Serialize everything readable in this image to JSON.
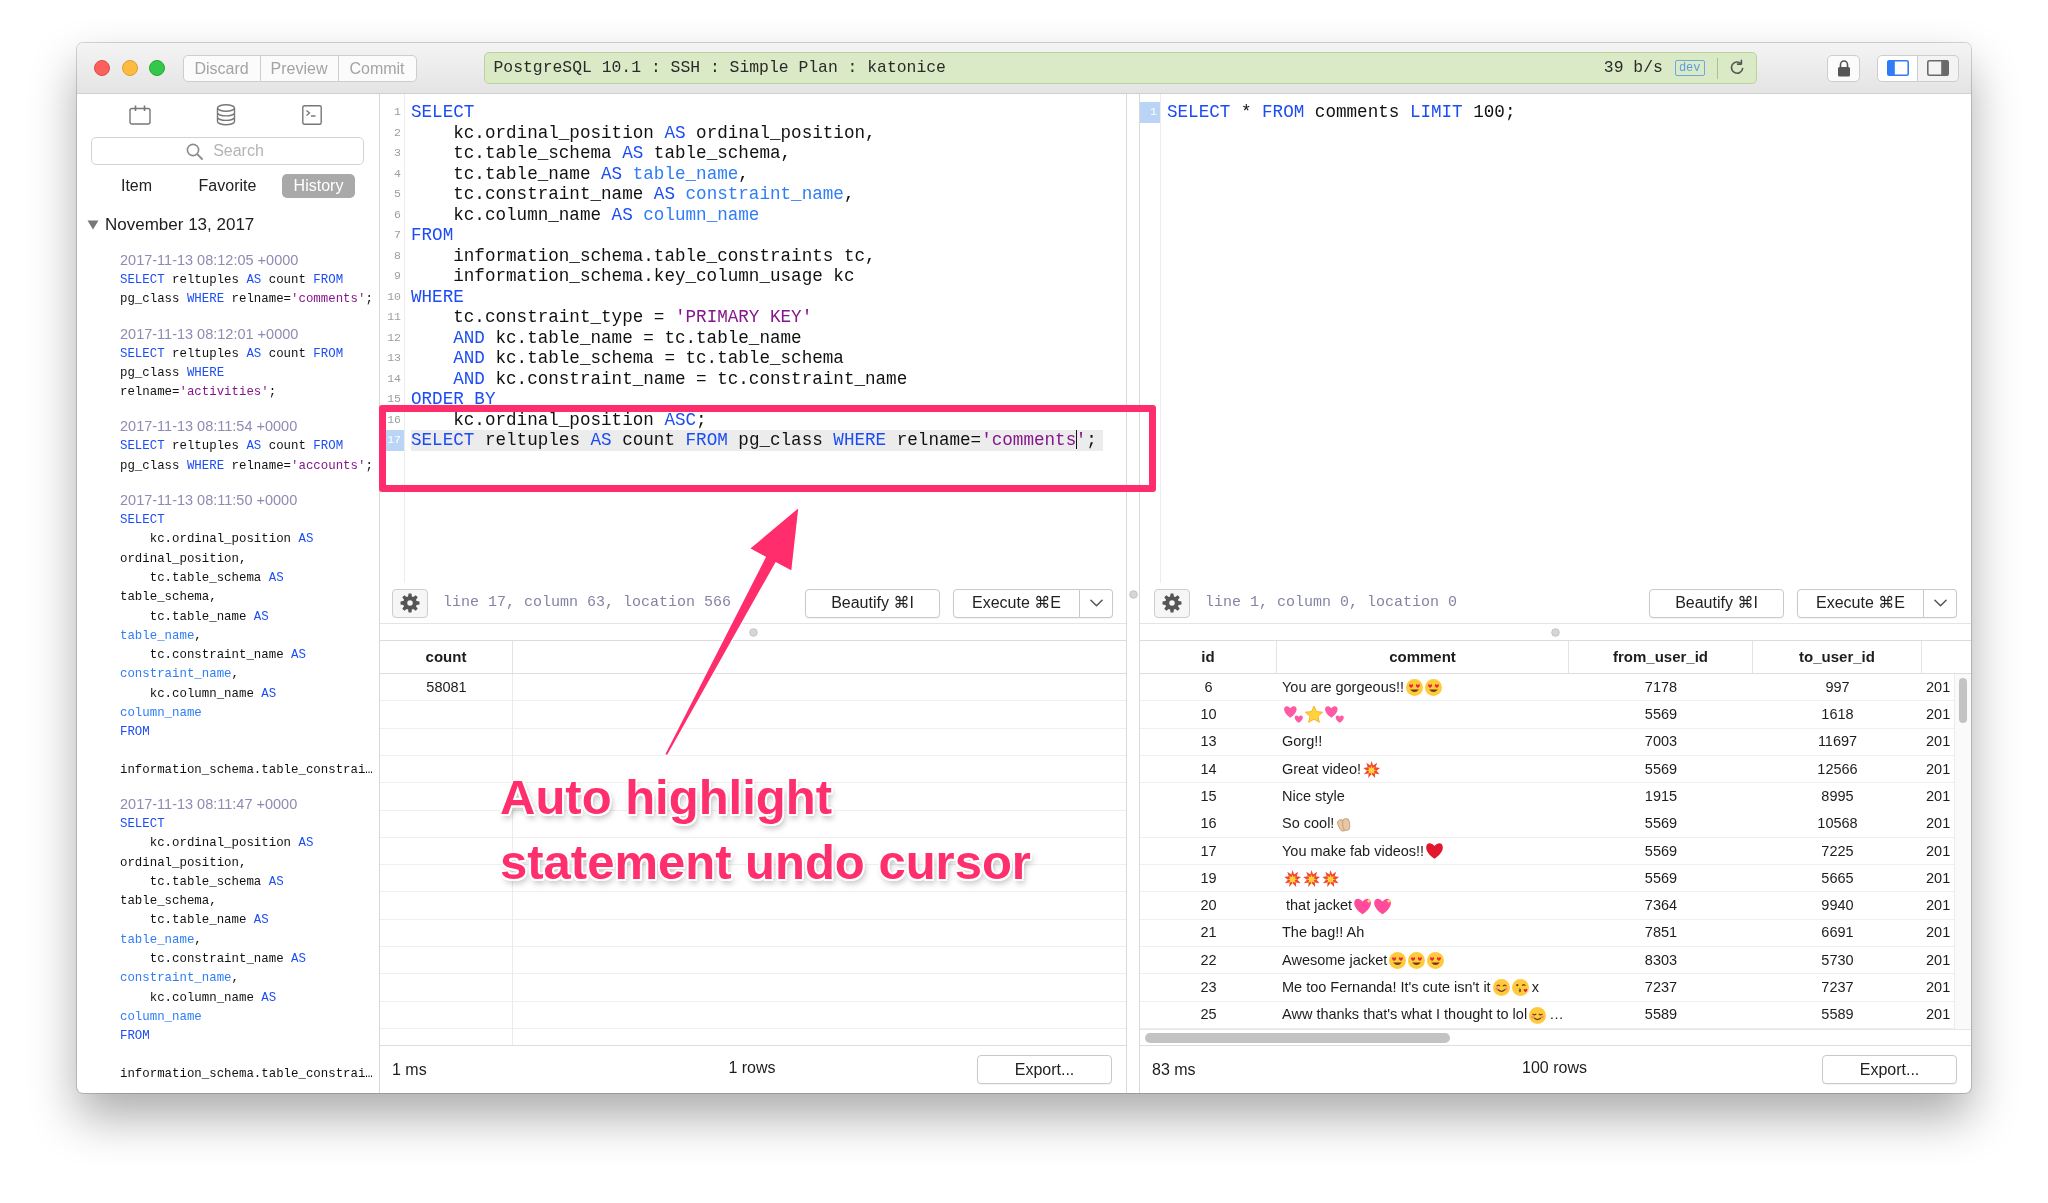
{
  "toolbar": {
    "buttons": [
      {
        "label": "Discard",
        "disabled": true
      },
      {
        "label": "Preview",
        "disabled": true
      },
      {
        "label": "Commit",
        "disabled": true
      }
    ],
    "connection": {
      "title": "PostgreSQL 10.1 : SSH : Simple Plan : katonice",
      "rate": "39 b/s",
      "environment": "dev"
    },
    "panel_toggles": [
      {
        "kind": "left",
        "selected": true
      },
      {
        "kind": "right",
        "selected": false
      }
    ]
  },
  "sidebar": {
    "search": {
      "placeholder": "Search"
    },
    "tabs": [
      {
        "label": "Item",
        "selected": false
      },
      {
        "label": "Favorite",
        "selected": false
      },
      {
        "label": "History",
        "selected": true
      }
    ],
    "history": [
      {
        "label": "November 13, 2017",
        "expanded": true,
        "children": [
          {
            "time": "2017-11-13 08:12:05 +0000",
            "lines": [
              [
                {
                  "kind": "keyword",
                  "text": "SELECT"
                },
                {
                  "kind": "plain",
                  "text": " reltuples "
                },
                {
                  "kind": "keyword",
                  "text": "AS"
                },
                {
                  "kind": "plain",
                  "text": " count "
                },
                {
                  "kind": "keyword",
                  "text": "FROM"
                }
              ],
              [
                {
                  "kind": "plain",
                  "text": "pg_class "
                },
                {
                  "kind": "keyword",
                  "text": "WHERE"
                },
                {
                  "kind": "plain",
                  "text": " relname="
                },
                {
                  "kind": "string",
                  "text": "'comments'"
                },
                {
                  "kind": "plain",
                  "text": ";"
                }
              ]
            ]
          },
          {
            "time": "2017-11-13 08:12:01 +0000",
            "lines": [
              [
                {
                  "kind": "keyword",
                  "text": "SELECT"
                },
                {
                  "kind": "plain",
                  "text": " reltuples "
                },
                {
                  "kind": "keyword",
                  "text": "AS"
                },
                {
                  "kind": "plain",
                  "text": " count "
                },
                {
                  "kind": "keyword",
                  "text": "FROM"
                }
              ],
              [
                {
                  "kind": "plain",
                  "text": "pg_class "
                },
                {
                  "kind": "keyword",
                  "text": "WHERE"
                }
              ],
              [
                {
                  "kind": "plain",
                  "text": "relname="
                },
                {
                  "kind": "string",
                  "text": "'activities'"
                },
                {
                  "kind": "plain",
                  "text": ";"
                }
              ]
            ]
          },
          {
            "time": "2017-11-13 08:11:54 +0000",
            "lines": [
              [
                {
                  "kind": "keyword",
                  "text": "SELECT"
                },
                {
                  "kind": "plain",
                  "text": " reltuples "
                },
                {
                  "kind": "keyword",
                  "text": "AS"
                },
                {
                  "kind": "plain",
                  "text": " count "
                },
                {
                  "kind": "keyword",
                  "text": "FROM"
                }
              ],
              [
                {
                  "kind": "plain",
                  "text": "pg_class "
                },
                {
                  "kind": "keyword",
                  "text": "WHERE"
                },
                {
                  "kind": "plain",
                  "text": " relname="
                },
                {
                  "kind": "string",
                  "text": "'accounts'"
                },
                {
                  "kind": "plain",
                  "text": ";"
                }
              ]
            ]
          },
          {
            "time": "2017-11-13 08:11:50 +0000",
            "lines": [
              [
                {
                  "kind": "keyword",
                  "text": "SELECT"
                }
              ],
              [
                {
                  "kind": "plain",
                  "text": "    kc.ordinal_position "
                },
                {
                  "kind": "keyword",
                  "text": "AS"
                }
              ],
              [
                {
                  "kind": "plain",
                  "text": "ordinal_position,"
                }
              ],
              [
                {
                  "kind": "plain",
                  "text": "    tc.table_schema "
                },
                {
                  "kind": "keyword",
                  "text": "AS"
                }
              ],
              [
                {
                  "kind": "plain",
                  "text": "table_schema,"
                }
              ],
              [
                {
                  "kind": "plain",
                  "text": "    tc.table_name "
                },
                {
                  "kind": "keyword",
                  "text": "AS"
                }
              ],
              [
                {
                  "kind": "name",
                  "text": "table_name"
                },
                {
                  "kind": "plain",
                  "text": ","
                }
              ],
              [
                {
                  "kind": "plain",
                  "text": "    tc.constraint_name "
                },
                {
                  "kind": "keyword",
                  "text": "AS"
                }
              ],
              [
                {
                  "kind": "name",
                  "text": "constraint_name"
                },
                {
                  "kind": "plain",
                  "text": ","
                }
              ],
              [
                {
                  "kind": "plain",
                  "text": "    kc.column_name "
                },
                {
                  "kind": "keyword",
                  "text": "AS"
                }
              ],
              [
                {
                  "kind": "name",
                  "text": "column_name"
                }
              ],
              [
                {
                  "kind": "keyword",
                  "text": "FROM"
                }
              ]
            ],
            "truncated_line": "information_schema.table_constrai…"
          },
          {
            "time": "2017-11-13 08:11:47 +0000",
            "lines": [
              [
                {
                  "kind": "keyword",
                  "text": "SELECT"
                }
              ],
              [
                {
                  "kind": "plain",
                  "text": "    kc.ordinal_position "
                },
                {
                  "kind": "keyword",
                  "text": "AS"
                }
              ],
              [
                {
                  "kind": "plain",
                  "text": "ordinal_position,"
                }
              ],
              [
                {
                  "kind": "plain",
                  "text": "    tc.table_schema "
                },
                {
                  "kind": "keyword",
                  "text": "AS"
                }
              ],
              [
                {
                  "kind": "plain",
                  "text": "table_schema,"
                }
              ],
              [
                {
                  "kind": "plain",
                  "text": "    tc.table_name "
                },
                {
                  "kind": "keyword",
                  "text": "AS"
                }
              ],
              [
                {
                  "kind": "name",
                  "text": "table_name"
                },
                {
                  "kind": "plain",
                  "text": ","
                }
              ],
              [
                {
                  "kind": "plain",
                  "text": "    tc.constraint_name "
                },
                {
                  "kind": "keyword",
                  "text": "AS"
                }
              ],
              [
                {
                  "kind": "name",
                  "text": "constraint_name"
                },
                {
                  "kind": "plain",
                  "text": ","
                }
              ],
              [
                {
                  "kind": "plain",
                  "text": "    kc.column_name "
                },
                {
                  "kind": "keyword",
                  "text": "AS"
                }
              ],
              [
                {
                  "kind": "name",
                  "text": "column_name"
                }
              ],
              [
                {
                  "kind": "keyword",
                  "text": "FROM"
                }
              ]
            ],
            "truncated_line": "information_schema.table_constrai…"
          }
        ]
      }
    ]
  },
  "panes": [
    {
      "editor": {
        "lines": [
          {
            "number": "1",
            "current": false,
            "highlighted": false,
            "segments": [
              {
                "kind": "keyword",
                "text": "SELECT"
              }
            ]
          },
          {
            "number": "2",
            "current": false,
            "highlighted": false,
            "segments": [
              {
                "kind": "plain",
                "text": "    kc.ordinal_position "
              },
              {
                "kind": "keyword",
                "text": "AS"
              },
              {
                "kind": "plain",
                "text": " ordinal_position,"
              }
            ]
          },
          {
            "number": "3",
            "current": false,
            "highlighted": false,
            "segments": [
              {
                "kind": "plain",
                "text": "    tc.table_schema "
              },
              {
                "kind": "keyword",
                "text": "AS"
              },
              {
                "kind": "plain",
                "text": " table_schema,"
              }
            ]
          },
          {
            "number": "4",
            "current": false,
            "highlighted": false,
            "segments": [
              {
                "kind": "plain",
                "text": "    tc.table_name "
              },
              {
                "kind": "keyword",
                "text": "AS"
              },
              {
                "kind": "name",
                "text": " table_name"
              },
              {
                "kind": "plain",
                "text": ","
              }
            ]
          },
          {
            "number": "5",
            "current": false,
            "highlighted": false,
            "segments": [
              {
                "kind": "plain",
                "text": "    tc.constraint_name "
              },
              {
                "kind": "keyword",
                "text": "AS"
              },
              {
                "kind": "name",
                "text": " constraint_name"
              },
              {
                "kind": "plain",
                "text": ","
              }
            ]
          },
          {
            "number": "6",
            "current": false,
            "highlighted": false,
            "segments": [
              {
                "kind": "plain",
                "text": "    kc.column_name "
              },
              {
                "kind": "keyword",
                "text": "AS"
              },
              {
                "kind": "name",
                "text": " column_name"
              }
            ]
          },
          {
            "number": "7",
            "current": false,
            "highlighted": false,
            "segments": [
              {
                "kind": "keyword",
                "text": "FROM"
              }
            ]
          },
          {
            "number": "8",
            "current": false,
            "highlighted": false,
            "segments": [
              {
                "kind": "plain",
                "text": "    information_schema.table_constraints tc,"
              }
            ]
          },
          {
            "number": "9",
            "current": false,
            "highlighted": false,
            "segments": [
              {
                "kind": "plain",
                "text": "    information_schema.key_column_usage kc"
              }
            ]
          },
          {
            "number": "10",
            "current": false,
            "highlighted": false,
            "segments": [
              {
                "kind": "keyword",
                "text": "WHERE"
              }
            ]
          },
          {
            "number": "11",
            "current": false,
            "highlighted": false,
            "segments": [
              {
                "kind": "plain",
                "text": "    tc.constraint_type = "
              },
              {
                "kind": "string",
                "text": "'PRIMARY KEY'"
              }
            ]
          },
          {
            "number": "12",
            "current": false,
            "highlighted": false,
            "segments": [
              {
                "kind": "keyword",
                "text": "    AND"
              },
              {
                "kind": "plain",
                "text": " kc.table_name = tc.table_name"
              }
            ]
          },
          {
            "number": "13",
            "current": false,
            "highlighted": false,
            "segments": [
              {
                "kind": "keyword",
                "text": "    AND"
              },
              {
                "kind": "plain",
                "text": " kc.table_schema = tc.table_schema"
              }
            ]
          },
          {
            "number": "14",
            "current": false,
            "highlighted": false,
            "segments": [
              {
                "kind": "keyword",
                "text": "    AND"
              },
              {
                "kind": "plain",
                "text": " kc.constraint_name = tc.constraint_name"
              }
            ]
          },
          {
            "number": "15",
            "current": false,
            "highlighted": false,
            "segments": [
              {
                "kind": "keyword",
                "text": "ORDER BY"
              }
            ]
          },
          {
            "number": "16",
            "current": false,
            "highlighted": false,
            "segments": [
              {
                "kind": "plain",
                "text": "    kc.ordinal_position "
              },
              {
                "kind": "keyword",
                "text": "ASC"
              },
              {
                "kind": "plain",
                "text": ";"
              }
            ]
          },
          {
            "number": "17",
            "current": true,
            "highlighted": true,
            "segments": [
              {
                "kind": "keyword",
                "text": "SELECT"
              },
              {
                "kind": "plain",
                "text": " reltuples "
              },
              {
                "kind": "keyword",
                "text": "AS"
              },
              {
                "kind": "plain",
                "text": " count "
              },
              {
                "kind": "keyword",
                "text": "FROM"
              },
              {
                "kind": "plain",
                "text": " pg_class "
              },
              {
                "kind": "keyword",
                "text": "WHERE"
              },
              {
                "kind": "plain",
                "text": " relname="
              },
              {
                "kind": "string",
                "text": "'comments"
              },
              {
                "kind": "cursor"
              },
              {
                "kind": "string",
                "text": "'"
              },
              {
                "kind": "plain",
                "text": ";"
              }
            ]
          }
        ]
      },
      "status": "line 17, column 63, location 566",
      "actions": [
        {
          "kind": "plain",
          "label": "Beautify ⌘I"
        },
        {
          "kind": "split",
          "label": "Execute ⌘E"
        }
      ],
      "results": {
        "columns": [
          "count"
        ],
        "rows": [
          {
            "cells": [
              "58081"
            ]
          }
        ]
      },
      "footer": {
        "time": "1 ms",
        "count": "1 rows",
        "export": "Export..."
      }
    },
    {
      "editor": {
        "lines": [
          {
            "number": "1",
            "current": true,
            "highlighted": false,
            "segments": [
              {
                "kind": "keyword",
                "text": "SELECT"
              },
              {
                "kind": "plain",
                "text": " * "
              },
              {
                "kind": "keyword",
                "text": "FROM"
              },
              {
                "kind": "plain",
                "text": " comments "
              },
              {
                "kind": "keyword",
                "text": "LIMIT"
              },
              {
                "kind": "plain",
                "text": " 100;"
              }
            ]
          }
        ]
      },
      "status": "line 1, column 0, location 0",
      "actions": [
        {
          "kind": "plain",
          "label": "Beautify ⌘I"
        },
        {
          "kind": "split",
          "label": "Execute ⌘E"
        }
      ],
      "results": {
        "columns": [
          "id",
          "comment",
          "from_user_id",
          "to_user_id"
        ],
        "rows": [
          {
            "cells": [
              "6",
              {
                "parts": [
                  {
                    "kind": "text",
                    "text": "You are gorgeous!!"
                  },
                  {
                    "kind": "lovestruck"
                  },
                  {
                    "kind": "lovestruck"
                  }
                ]
              },
              "7178",
              "997",
              "201"
            ]
          },
          {
            "cells": [
              "10",
              {
                "parts": [
                  {
                    "kind": "hearts"
                  },
                  {
                    "kind": "star"
                  },
                  {
                    "kind": "hearts"
                  }
                ]
              },
              "5569",
              "1618",
              "201"
            ]
          },
          {
            "cells": [
              "13",
              "Gorg!!",
              "7003",
              "11697",
              "201"
            ]
          },
          {
            "cells": [
              "14",
              {
                "parts": [
                  {
                    "kind": "text",
                    "text": "Great video!"
                  },
                  {
                    "kind": "boom"
                  }
                ]
              },
              "5569",
              "12566",
              "201"
            ]
          },
          {
            "cells": [
              "15",
              "Nice style",
              "1915",
              "8995",
              "201"
            ]
          },
          {
            "cells": [
              "16",
              {
                "parts": [
                  {
                    "kind": "text",
                    "text": "So cool!"
                  },
                  {
                    "kind": "clap"
                  }
                ]
              },
              "5569",
              "10568",
              "201"
            ]
          },
          {
            "cells": [
              "17",
              {
                "parts": [
                  {
                    "kind": "text",
                    "text": "You make fab videos!!"
                  },
                  {
                    "kind": "heart"
                  }
                ]
              },
              "5569",
              "7225",
              "201"
            ]
          },
          {
            "cells": [
              "19",
              {
                "parts": [
                  {
                    "kind": "boom"
                  },
                  {
                    "kind": "boom"
                  },
                  {
                    "kind": "boom"
                  }
                ]
              },
              "5569",
              "5665",
              "201"
            ]
          },
          {
            "cells": [
              "20",
              {
                "parts": [
                  {
                    "kind": "text",
                    "text": " that jacket"
                  },
                  {
                    "kind": "sparkleheart"
                  },
                  {
                    "kind": "sparkleheart"
                  }
                ]
              },
              "7364",
              "9940",
              "201"
            ]
          },
          {
            "cells": [
              "21",
              "The bag!! Ah",
              "7851",
              "6691",
              "201"
            ]
          },
          {
            "cells": [
              "22",
              {
                "parts": [
                  {
                    "kind": "text",
                    "text": "Awesome jacket"
                  },
                  {
                    "kind": "lovestruck"
                  },
                  {
                    "kind": "lovestruck"
                  },
                  {
                    "kind": "lovestruck"
                  }
                ]
              },
              "8303",
              "5730",
              "201"
            ]
          },
          {
            "cells": [
              "23",
              {
                "parts": [
                  {
                    "kind": "text",
                    "text": "Me too Fernanda! It's cute isn't it"
                  },
                  {
                    "kind": "smile"
                  },
                  {
                    "kind": "kiss"
                  },
                  {
                    "kind": "text",
                    "text": "x"
                  }
                ]
              },
              "7237",
              "7237",
              "201"
            ]
          },
          {
            "cells": [
              "25",
              {
                "parts": [
                  {
                    "kind": "text",
                    "text": "Aww thanks that's what I thought to lol"
                  },
                  {
                    "kind": "content"
                  },
                  {
                    "kind": "text",
                    "text": "…"
                  }
                ]
              },
              "5589",
              "5589",
              "201"
            ]
          }
        ]
      },
      "footer": {
        "time": "83 ms",
        "count": "100 rows",
        "export": "Export..."
      }
    }
  ],
  "annotation": {
    "text": "Auto highlight statement undo cursor"
  }
}
